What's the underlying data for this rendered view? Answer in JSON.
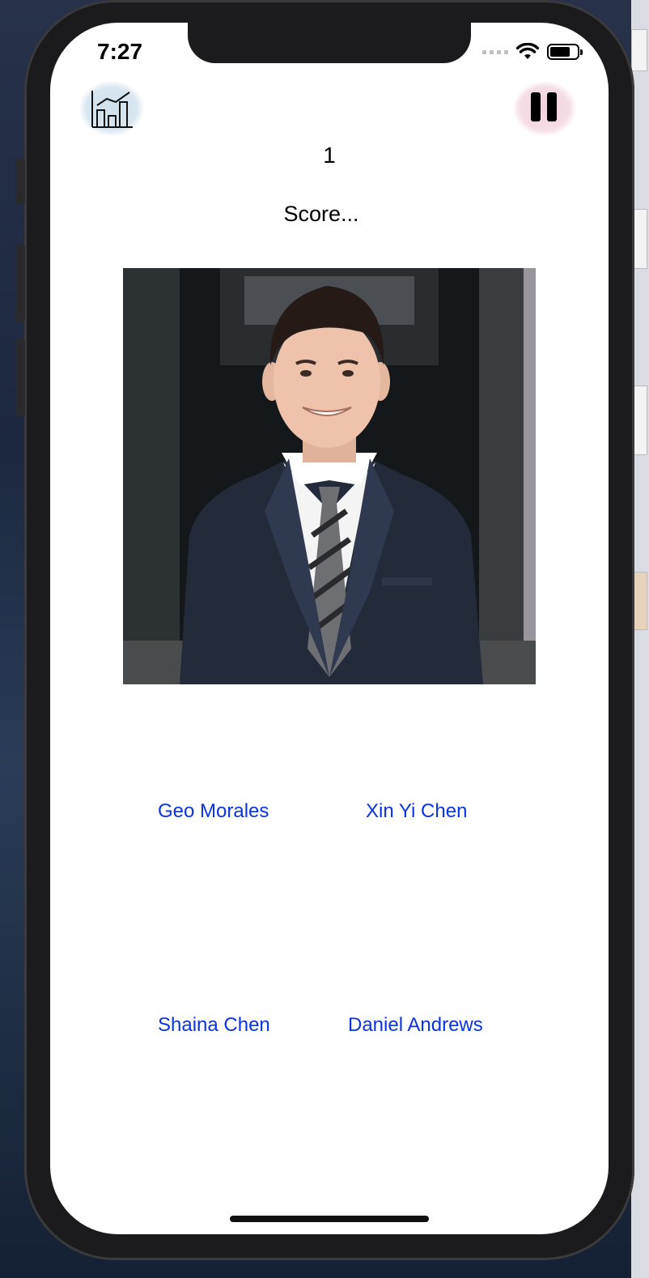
{
  "status_bar": {
    "time": "7:27"
  },
  "header": {
    "stats_icon": "bar-chart-icon",
    "pause_icon": "pause-icon"
  },
  "game": {
    "counter": "1",
    "score_label": "Score...",
    "photo_alt": "Photo of person to identify"
  },
  "choices": [
    {
      "label": "Geo Morales"
    },
    {
      "label": "Xin Yi Chen"
    },
    {
      "label": "Shaina Chen"
    },
    {
      "label": "Daniel Andrews"
    }
  ],
  "colors": {
    "choice_text": "#0a33e6",
    "stats_bg": "#d8e6f0",
    "pause_bg": "#f5dde5"
  }
}
